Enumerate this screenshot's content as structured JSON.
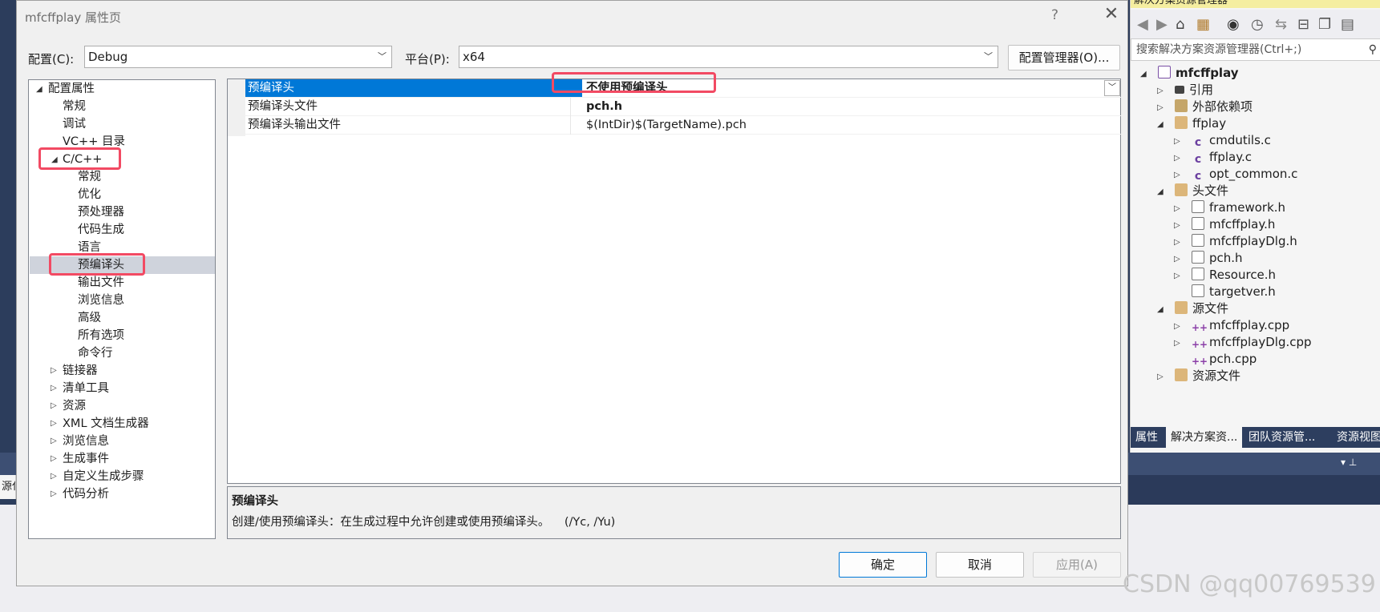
{
  "dialog": {
    "title": "mfcffplay 属性页",
    "help": "?",
    "close": "✕",
    "config_label": "配置(C):",
    "config_value": "Debug",
    "platform_label": "平台(P):",
    "platform_value": "x64",
    "config_manager": "配置管理器(O)...",
    "ok": "确定",
    "cancel": "取消",
    "apply": "应用(A)"
  },
  "tree": {
    "root": "配置属性",
    "general": "常规",
    "debug": "调试",
    "vcdirs": "VC++ 目录",
    "cpp": "C/C++",
    "cpp_children": [
      "常规",
      "优化",
      "预处理器",
      "代码生成",
      "语言",
      "预编译头",
      "输出文件",
      "浏览信息",
      "高级",
      "所有选项",
      "命令行"
    ],
    "others": [
      "链接器",
      "清单工具",
      "资源",
      "XML 文档生成器",
      "浏览信息",
      "生成事件",
      "自定义生成步骤",
      "代码分析"
    ]
  },
  "grid": {
    "rows": [
      {
        "name": "预编译头",
        "value": "不使用预编译头"
      },
      {
        "name": "预编译头文件",
        "value": "pch.h"
      },
      {
        "name": "预编译头输出文件",
        "value": "$(IntDir)$(TargetName).pch"
      }
    ]
  },
  "description": {
    "title": "预编译头",
    "text": "创建/使用预编译头：在生成过程中允许创建或使用预编译头。    (/Yc, /Yu)"
  },
  "solution_explorer": {
    "title": "解决方案资源管理器",
    "search_placeholder": "搜索解决方案资源管理器(Ctrl+;)",
    "items": [
      {
        "label": "mfcffplay",
        "icon": "project-icon"
      },
      {
        "label": "引用",
        "icon": "references-icon"
      },
      {
        "label": "外部依赖项",
        "icon": "external-deps-icon"
      },
      {
        "label": "ffplay",
        "icon": "folder-icon"
      },
      {
        "label": "cmdutils.c",
        "icon": "c-file-icon"
      },
      {
        "label": "ffplay.c",
        "icon": "c-file-icon"
      },
      {
        "label": "opt_common.c",
        "icon": "c-file-icon"
      },
      {
        "label": "头文件",
        "icon": "folder-icon"
      },
      {
        "label": "framework.h",
        "icon": "header-file-icon"
      },
      {
        "label": "mfcffplay.h",
        "icon": "header-file-icon"
      },
      {
        "label": "mfcffplayDlg.h",
        "icon": "header-file-icon"
      },
      {
        "label": "pch.h",
        "icon": "header-file-icon"
      },
      {
        "label": "Resource.h",
        "icon": "header-file-icon"
      },
      {
        "label": "targetver.h",
        "icon": "header-file-icon"
      },
      {
        "label": "源文件",
        "icon": "folder-icon"
      },
      {
        "label": "mfcffplay.cpp",
        "icon": "cpp-file-icon"
      },
      {
        "label": "mfcffplayDlg.cpp",
        "icon": "cpp-file-icon"
      },
      {
        "label": "pch.cpp",
        "icon": "cpp-file-icon"
      },
      {
        "label": "资源文件",
        "icon": "folder-icon"
      }
    ],
    "tabs": [
      "属性",
      "解决方案资...",
      "团队资源管...",
      "资源视图"
    ]
  },
  "background_left_text": "源代",
  "watermark": "CSDN @qq00769539"
}
